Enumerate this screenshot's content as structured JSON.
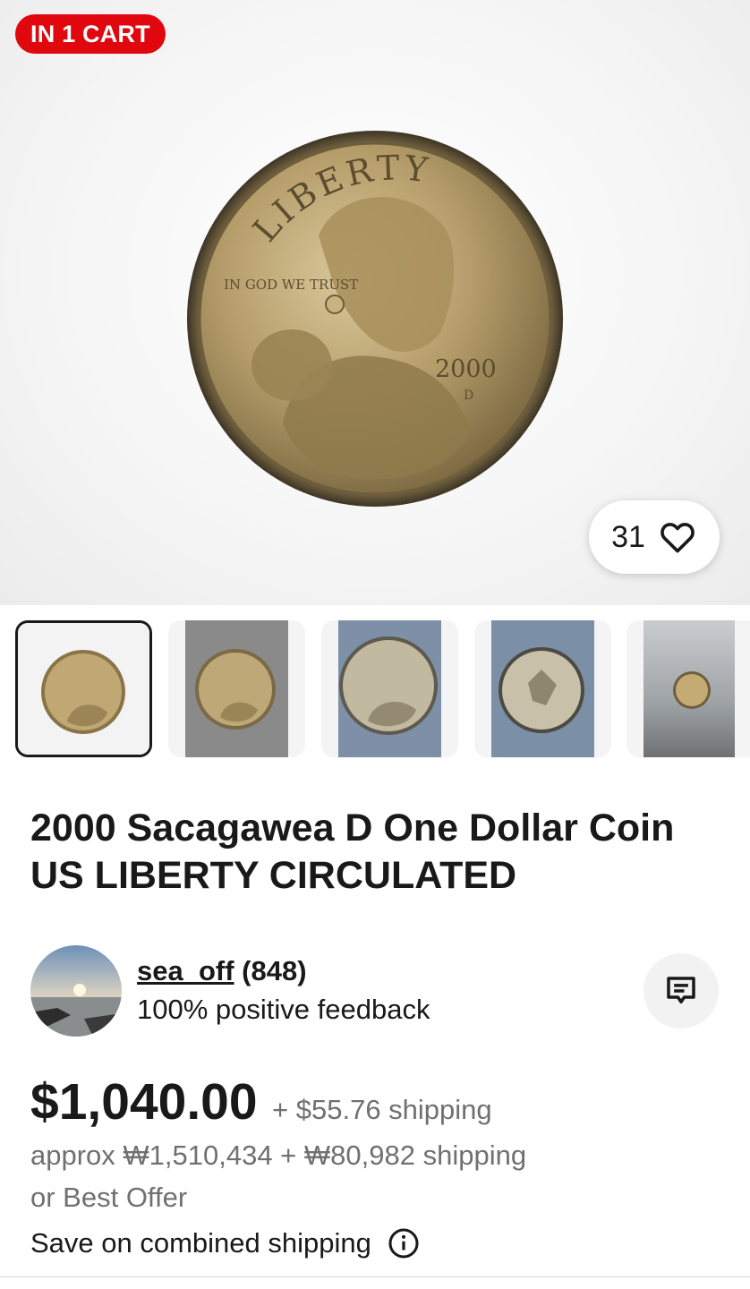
{
  "badge": {
    "text": "IN 1 CART",
    "color": "#e0070f"
  },
  "watchers": {
    "count": "31",
    "icon": "heart-icon"
  },
  "thumbnails": [
    {
      "name": "coin-obverse-white"
    },
    {
      "name": "coin-obverse-grey"
    },
    {
      "name": "coin-obverse-blue"
    },
    {
      "name": "coin-reverse-blue"
    },
    {
      "name": "coin-small-grey"
    }
  ],
  "listing": {
    "title": "2000 Sacagawea D One Dollar Coin US LIBERTY CIRCULATED"
  },
  "seller": {
    "name": "sea_off",
    "score": "(848)",
    "feedback": "100% positive feedback",
    "message_icon": "message-icon"
  },
  "pricing": {
    "price": "$1,040.00",
    "shipping": "+ $55.76 shipping",
    "approx": "approx ₩1,510,434 + ₩80,982 shipping",
    "offer": "or Best Offer",
    "combined": "Save on combined shipping",
    "info_icon": "info-icon"
  },
  "coin_inscriptions": {
    "top": "LIBERTY",
    "motto": "IN GOD WE TRUST",
    "year": "2000",
    "mint": "D"
  }
}
